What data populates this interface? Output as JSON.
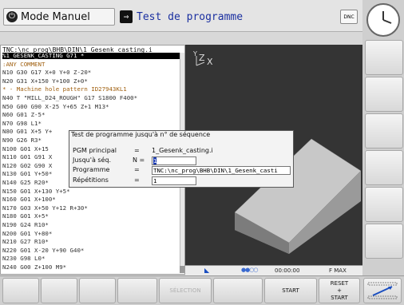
{
  "header": {
    "mode": "Mode Manuel",
    "program_mode": "Test de programme",
    "dnc_label": "DNC"
  },
  "program": {
    "path": "TNC:\\nc_prog\\BHB\\DIN\\1_Gesenk_casting.i",
    "lines": [
      "%1_GESENK_CASTING G71 *",
      ":ANY COMMENT",
      "N10 G30 G17 X+0 Y+0 Z-20*",
      "N20 G31 X+150 Y+100 Z+0*",
      "* - Machine hole pattern ID27943KL1",
      "N40 T \"MILL_D24_ROUGH\" G17 S1800 F400*",
      "N50 G00 G90 X-25 Y+65 Z+1 M13*",
      "N60 G01 Z-5*",
      "N70 G98 L1*",
      "N80 G01 X+5 Y+",
      "N90 G26 R3*",
      "N100 G01 X+15",
      "N110 G01 G91 X",
      "N120 G02 G90 X",
      "N130 G01 Y+50*",
      "N140 G25 R20*",
      "N150 G01 X+130 Y+5*",
      "N160 G01 X+100*",
      "N170 G03 X+50 Y+12 R+30*",
      "N180 G01 X+5*",
      "N190 G24 R10*",
      "N200 G01 Y+80*",
      "N210 G27 R10*",
      "N220 G01 X-20 Y+90 G40*",
      "N230 G98 L0*",
      "N240 G00 Z+100 M9*"
    ]
  },
  "dialog": {
    "title": "Test de programme jusqu'à n° de séquence",
    "rows": [
      {
        "label": "PGM principal",
        "sep": "=",
        "value": "1_Gesenk_casting.i"
      },
      {
        "label": "Jusqu'à séq.",
        "sep": "N =",
        "value": "1"
      },
      {
        "label": "Programme",
        "sep": "=",
        "value": "TNC:\\nc_prog\\BHB\\DIN\\1_Gesenk_casti"
      },
      {
        "label": "Répétitions",
        "sep": "=",
        "value": "1"
      }
    ]
  },
  "view3d": {
    "axis_y": "Y",
    "axis_z": "Z",
    "axis_x": "X"
  },
  "status": {
    "time": "00:00:00",
    "feed": "F MAX"
  },
  "softkeys": {
    "selection": "SÉLECTION",
    "start": "START",
    "reset_start_1": "RESET",
    "reset_start_2": "+",
    "reset_start_3": "START"
  }
}
